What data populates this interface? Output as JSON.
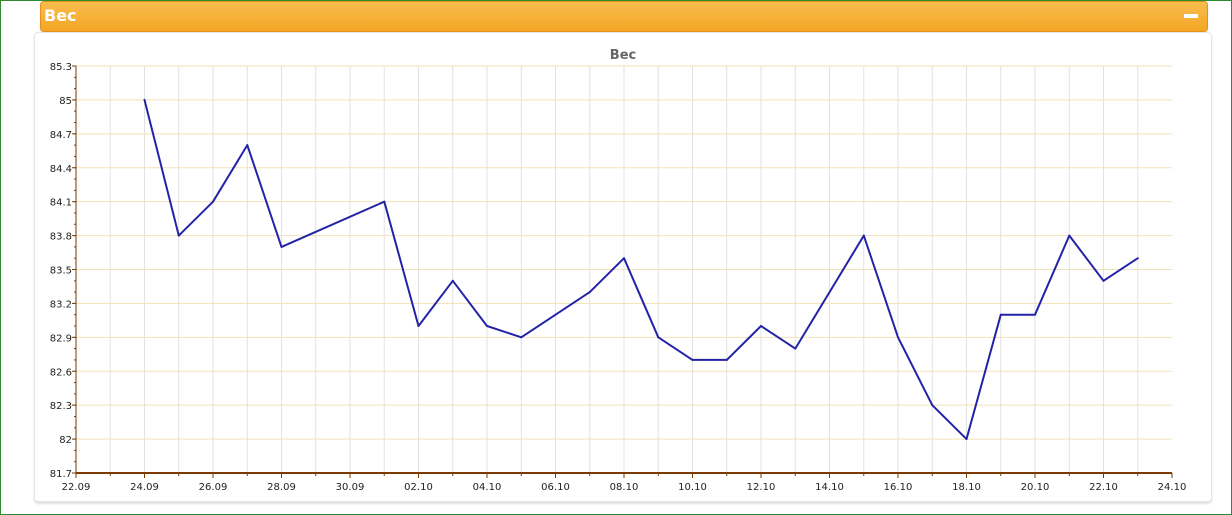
{
  "panel": {
    "title": "Вес",
    "collapse_icon": "minus-icon"
  },
  "colors": {
    "header": "#f5ab2e",
    "line": "#2323a8",
    "grid_h": "#f0e2b8",
    "grid_v": "#e2e2e2",
    "axis": "#7a3a00"
  },
  "chart_data": {
    "type": "line",
    "title": "Вес",
    "xlabel": "",
    "ylabel": "",
    "ylim": [
      81.7,
      85.3
    ],
    "yticks": [
      "81.7",
      "82",
      "82.3",
      "82.6",
      "82.9",
      "83.2",
      "83.5",
      "83.8",
      "84.1",
      "84.4",
      "84.7",
      "85",
      "85.3"
    ],
    "xlim": [
      "2023-09-22",
      "2023-10-24"
    ],
    "xticks": [
      "22.09",
      "24.09",
      "26.09",
      "28.09",
      "30.09",
      "02.10",
      "04.10",
      "06.10",
      "08.10",
      "10.10",
      "12.10",
      "14.10",
      "16.10",
      "18.10",
      "20.10",
      "22.10",
      "24.10"
    ],
    "grid": true,
    "series": [
      {
        "points": [
          {
            "x": "2023-09-24",
            "y": 85.0
          },
          {
            "x": "2023-09-25",
            "y": 83.8
          },
          {
            "x": "2023-09-26",
            "y": 84.1
          },
          {
            "x": "2023-09-27",
            "y": 84.6
          },
          {
            "x": "2023-09-28",
            "y": 83.7
          },
          {
            "x": "2023-10-01",
            "y": 84.1
          },
          {
            "x": "2023-10-02",
            "y": 83.0
          },
          {
            "x": "2023-10-03",
            "y": 83.4
          },
          {
            "x": "2023-10-04",
            "y": 83.0
          },
          {
            "x": "2023-10-05",
            "y": 82.9
          },
          {
            "x": "2023-10-07",
            "y": 83.3
          },
          {
            "x": "2023-10-08",
            "y": 83.6
          },
          {
            "x": "2023-10-09",
            "y": 82.9
          },
          {
            "x": "2023-10-10",
            "y": 82.7
          },
          {
            "x": "2023-10-11",
            "y": 82.7
          },
          {
            "x": "2023-10-12",
            "y": 83.0
          },
          {
            "x": "2023-10-13",
            "y": 82.8
          },
          {
            "x": "2023-10-15",
            "y": 83.8
          },
          {
            "x": "2023-10-16",
            "y": 82.9
          },
          {
            "x": "2023-10-17",
            "y": 82.3
          },
          {
            "x": "2023-10-18",
            "y": 82.0
          },
          {
            "x": "2023-10-19",
            "y": 83.1
          },
          {
            "x": "2023-10-20",
            "y": 83.1
          },
          {
            "x": "2023-10-21",
            "y": 83.8
          },
          {
            "x": "2023-10-22",
            "y": 83.4
          },
          {
            "x": "2023-10-23",
            "y": 83.6
          }
        ]
      }
    ]
  }
}
